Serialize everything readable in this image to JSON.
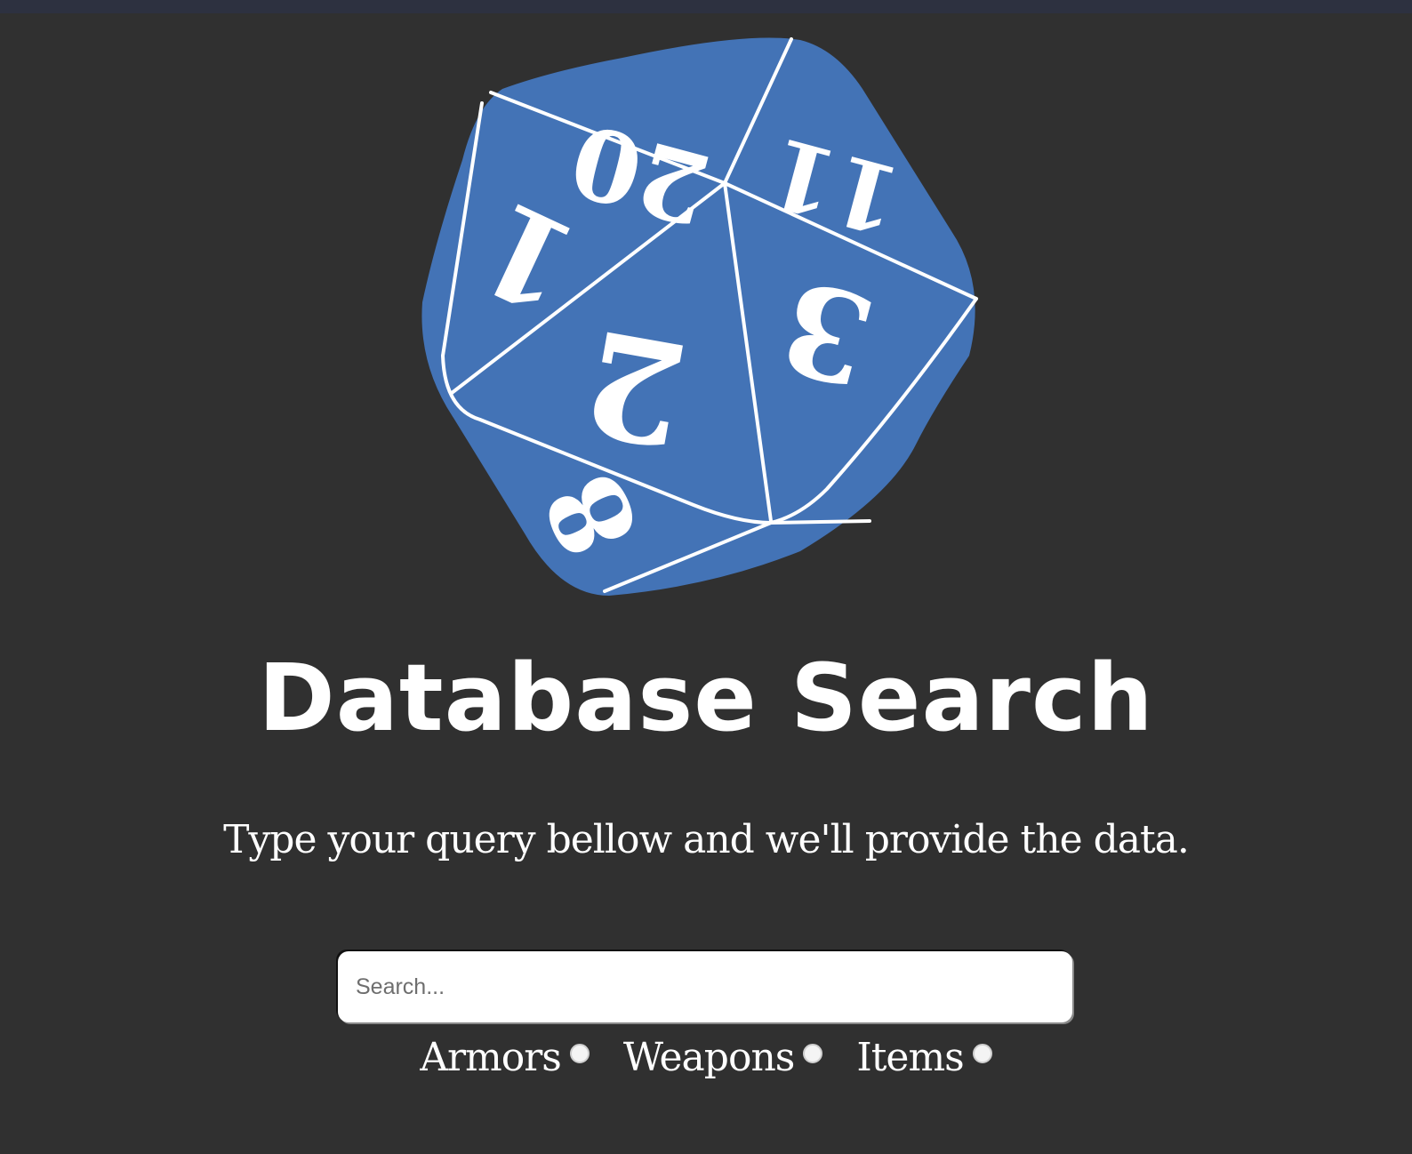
{
  "logo": {
    "faces": [
      "20",
      "11",
      "1",
      "2",
      "3",
      "8"
    ],
    "fill_color": "#4373b6",
    "line_color": "#ffffff"
  },
  "title": "Database Search",
  "subtitle": "Type your query bellow and we'll provide the data.",
  "search": {
    "placeholder": "Search...",
    "value": ""
  },
  "filters": [
    {
      "label": "Armors",
      "selected": false
    },
    {
      "label": "Weapons",
      "selected": false
    },
    {
      "label": "Items",
      "selected": false
    }
  ],
  "colors": {
    "background": "#303030",
    "accent": "#4373b6",
    "text": "#ffffff"
  }
}
